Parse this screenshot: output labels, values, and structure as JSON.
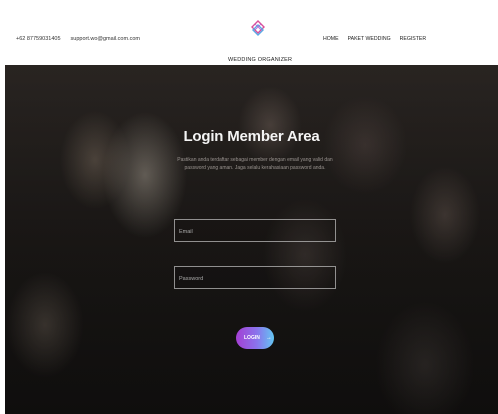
{
  "header": {
    "phone": "+62 87759031405",
    "email": "support.wo@gmail.com.com",
    "brand_name": "WEDDING ORGANIZER",
    "nav": [
      "HOME",
      "PAKET WEDDING",
      "REGISTER"
    ]
  },
  "login": {
    "title": "Login Member Area",
    "subtitle": "Pastikan anda terdaftar sebagai member dengan email yang valid dan password yang aman. Jaga selalu kerahasiaan password anda.",
    "email_placeholder": "Email",
    "password_placeholder": "Password",
    "button_label": "LOGIN",
    "button_icon": "arrow-right-icon"
  },
  "colors": {
    "button_gradient_start": "#a43fd4",
    "button_gradient_mid": "#8a74ec",
    "button_gradient_end": "#63c6f2",
    "logo_pink": "#d94f9a",
    "logo_blue": "#5aa9e6"
  }
}
